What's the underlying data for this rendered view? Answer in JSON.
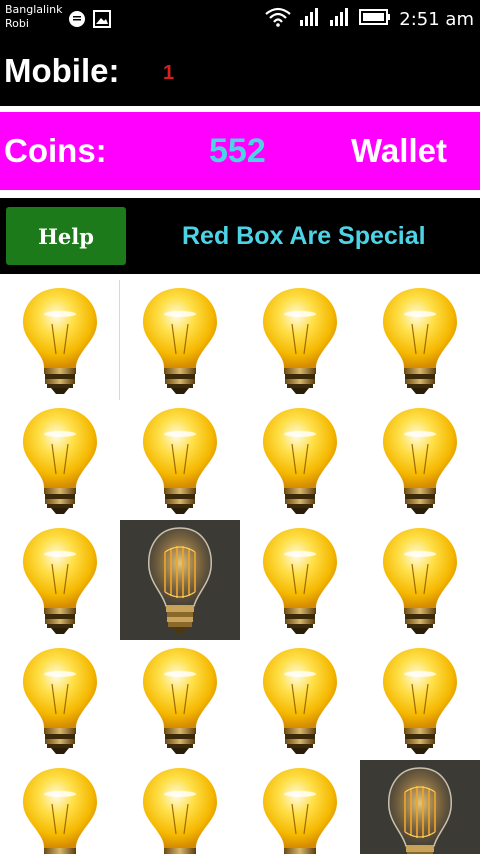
{
  "status_bar": {
    "carrier_line1": "Banglalink",
    "carrier_line2": "Robi",
    "time": "2:51 am",
    "icons": [
      "message-icon",
      "image-icon",
      "wifi-icon",
      "signal-icon",
      "signal-icon",
      "battery-icon"
    ]
  },
  "header": {
    "mobile_label": "Mobile:",
    "mobile_value": "1"
  },
  "coins_bar": {
    "label": "Coins:",
    "value": "552",
    "wallet_label": "Wallet"
  },
  "help_bar": {
    "help_label": "Help",
    "special_text": "Red Box Are Special"
  },
  "grid": {
    "columns": 4,
    "visible_rows": 5,
    "cells": [
      "yellow-bulb",
      "yellow-bulb",
      "yellow-bulb",
      "yellow-bulb",
      "yellow-bulb",
      "yellow-bulb",
      "yellow-bulb",
      "yellow-bulb",
      "yellow-bulb",
      "vintage-bulb",
      "yellow-bulb",
      "yellow-bulb",
      "yellow-bulb",
      "yellow-bulb",
      "yellow-bulb",
      "yellow-bulb",
      "yellow-bulb",
      "yellow-bulb",
      "yellow-bulb",
      "vintage-bulb"
    ]
  },
  "colors": {
    "header_bg": "#000000",
    "coins_bar_bg": "#ff00ff",
    "coins_value": "#4dd3e6",
    "mobile_value": "#d62020",
    "help_button": "#1d7a1a",
    "special_text": "#4dd3e6",
    "special_cell_bg": "#3c3a35"
  }
}
